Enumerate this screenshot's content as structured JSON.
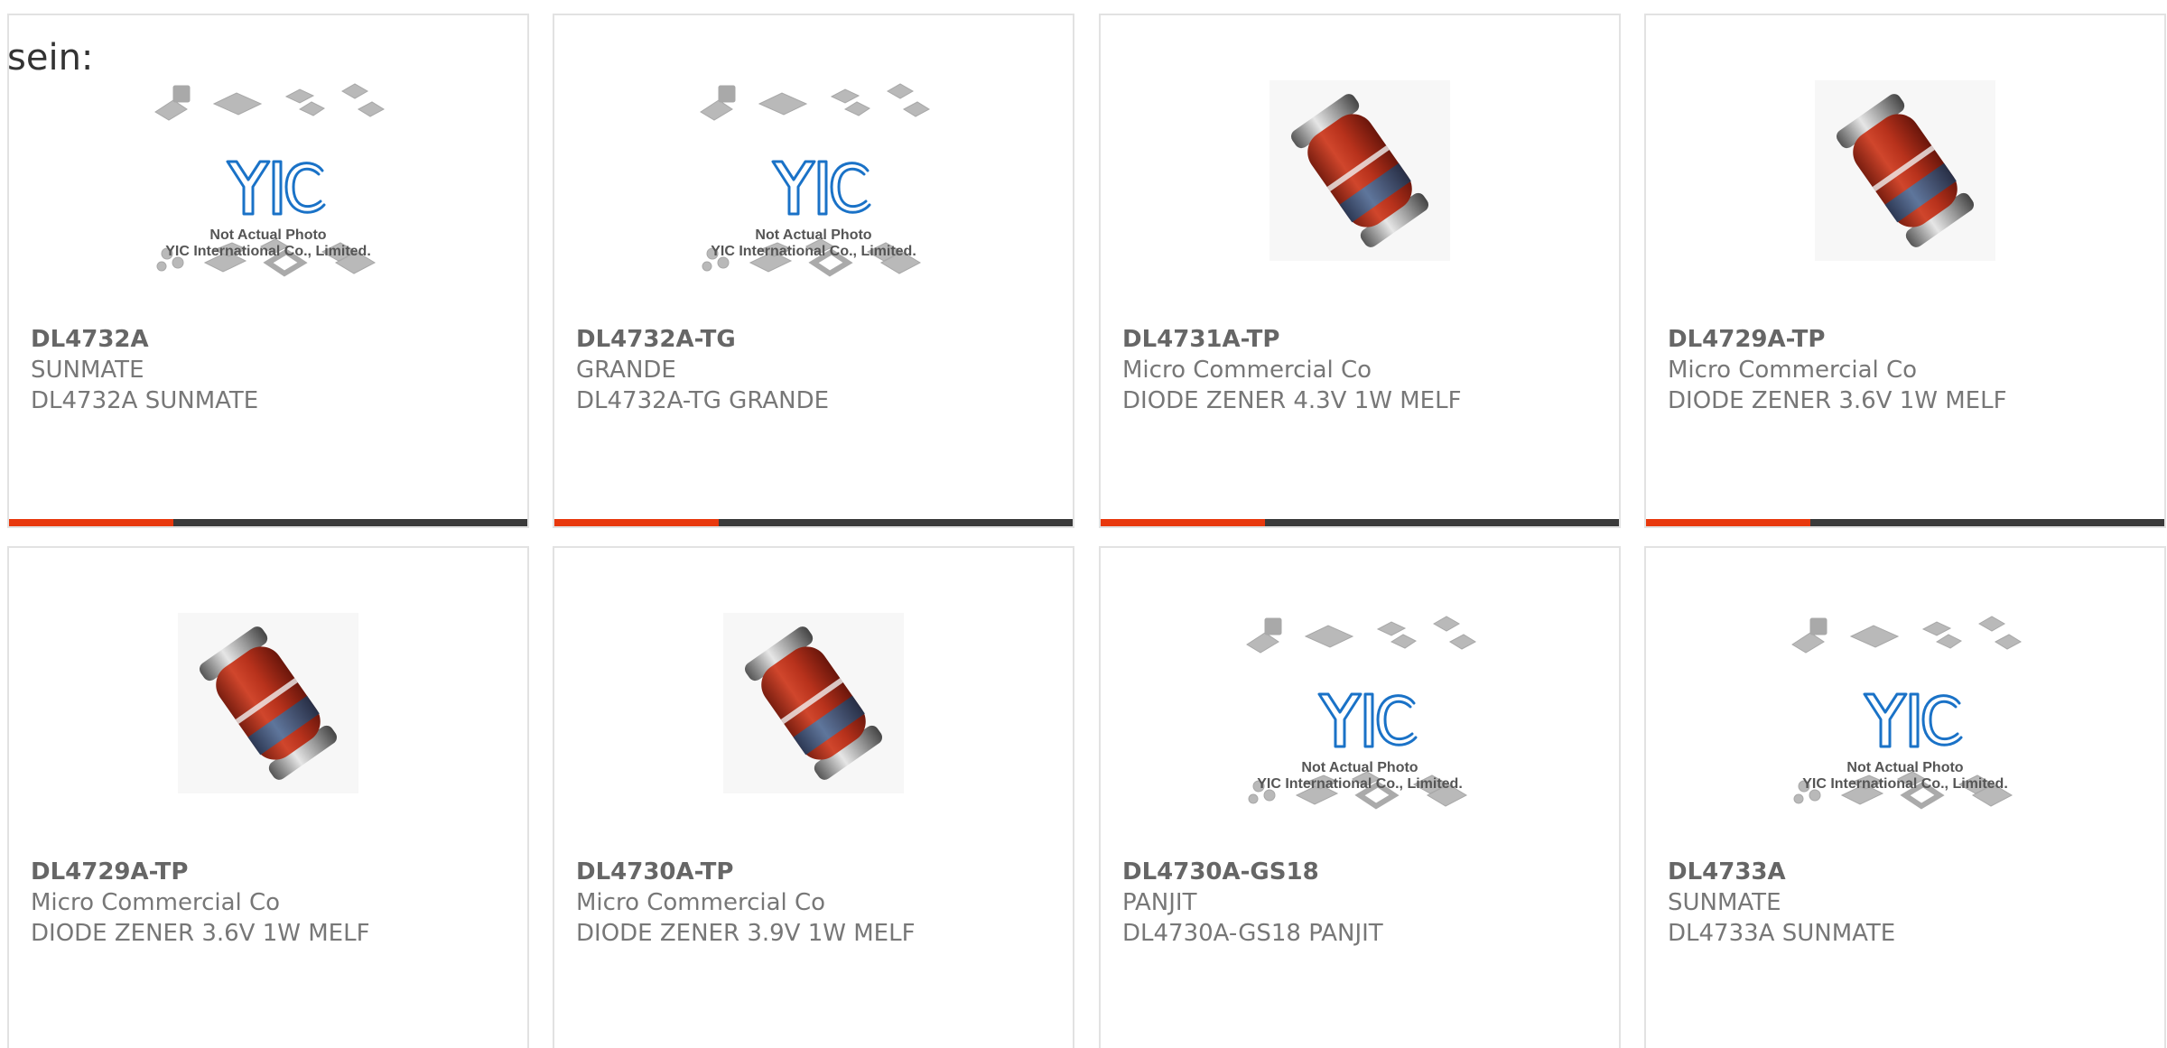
{
  "heading": "sein:",
  "colors": {
    "accent": "#e8380d",
    "bar": "#3a3a3a",
    "border": "#e2e2e2",
    "text": "#666666",
    "logo": "#1a72c7"
  },
  "placeholder": {
    "logo_text": "YIC",
    "line1": "Not Actual Photo",
    "line2": "YIC International Co., Limited."
  },
  "cards": [
    {
      "part": "DL4732A",
      "maker": "SUNMATE",
      "desc": "DL4732A SUNMATE",
      "image": "placeholder",
      "icon": "yic-placeholder-image"
    },
    {
      "part": "DL4732A-TG",
      "maker": "GRANDE",
      "desc": "DL4732A-TG GRANDE",
      "image": "placeholder",
      "icon": "yic-placeholder-image"
    },
    {
      "part": "DL4731A-TP",
      "maker": "Micro Commercial Co",
      "desc": "DIODE ZENER 4.3V 1W MELF",
      "image": "diode",
      "icon": "melf-diode-image"
    },
    {
      "part": "DL4729A-TP",
      "maker": "Micro Commercial Co",
      "desc": "DIODE ZENER 3.6V 1W MELF",
      "image": "diode",
      "icon": "melf-diode-image"
    },
    {
      "part": "DL4729A-TP",
      "maker": "Micro Commercial Co",
      "desc": "DIODE ZENER 3.6V 1W MELF",
      "image": "diode",
      "icon": "melf-diode-image"
    },
    {
      "part": "DL4730A-TP",
      "maker": "Micro Commercial Co",
      "desc": "DIODE ZENER 3.9V 1W MELF",
      "image": "diode",
      "icon": "melf-diode-image"
    },
    {
      "part": "DL4730A-GS18",
      "maker": "PANJIT",
      "desc": "DL4730A-GS18 PANJIT",
      "image": "placeholder",
      "icon": "yic-placeholder-image"
    },
    {
      "part": "DL4733A",
      "maker": "SUNMATE",
      "desc": "DL4733A SUNMATE",
      "image": "placeholder",
      "icon": "yic-placeholder-image"
    }
  ]
}
